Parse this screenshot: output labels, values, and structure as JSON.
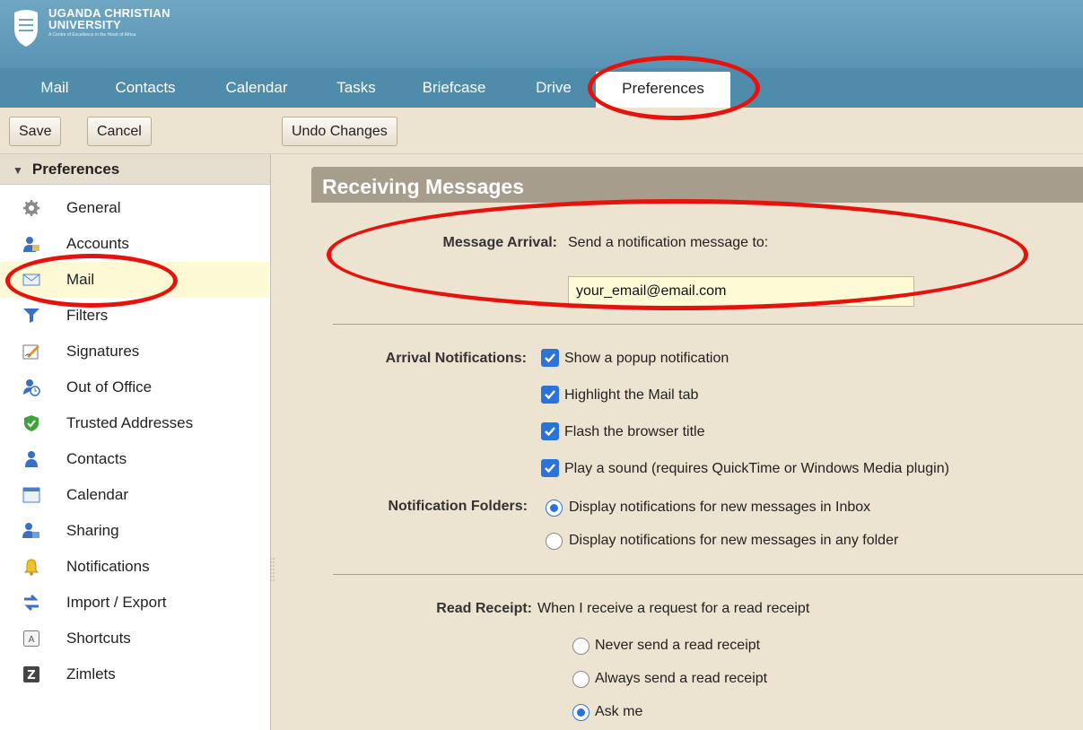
{
  "brand": {
    "line1": "UGANDA CHRISTIAN",
    "line2": "UNIVERSITY",
    "tagline": "A Centre of Excellence in the Heart of Africa"
  },
  "tabs": [
    {
      "label": "Mail"
    },
    {
      "label": "Contacts"
    },
    {
      "label": "Calendar"
    },
    {
      "label": "Tasks"
    },
    {
      "label": "Briefcase"
    },
    {
      "label": "Drive"
    },
    {
      "label": "Preferences"
    }
  ],
  "toolbar": {
    "save_label": "Save",
    "cancel_label": "Cancel",
    "undo_label": "Undo Changes"
  },
  "sidebar": {
    "header": "Preferences",
    "items": [
      {
        "label": "General",
        "icon": "gear-icon"
      },
      {
        "label": "Accounts",
        "icon": "accounts-icon"
      },
      {
        "label": "Mail",
        "icon": "envelope-icon"
      },
      {
        "label": "Filters",
        "icon": "filter-icon"
      },
      {
        "label": "Signatures",
        "icon": "signature-icon"
      },
      {
        "label": "Out of Office",
        "icon": "out-of-office-icon"
      },
      {
        "label": "Trusted Addresses",
        "icon": "shield-icon"
      },
      {
        "label": "Contacts",
        "icon": "person-icon"
      },
      {
        "label": "Calendar",
        "icon": "calendar-icon"
      },
      {
        "label": "Sharing",
        "icon": "sharing-icon"
      },
      {
        "label": "Notifications",
        "icon": "bell-icon"
      },
      {
        "label": "Import / Export",
        "icon": "import-export-icon"
      },
      {
        "label": "Shortcuts",
        "icon": "keyboard-icon"
      },
      {
        "label": "Zimlets",
        "icon": "zimlet-icon"
      }
    ]
  },
  "main": {
    "section_title": "Receiving Messages",
    "message_arrival": {
      "label": "Message Arrival:",
      "text": "Send a notification message to:",
      "email_value": "your_email@email.com"
    },
    "arrival_notifications": {
      "label": "Arrival Notifications:",
      "options": [
        {
          "text": "Show a popup notification",
          "checked": true
        },
        {
          "text": "Highlight the Mail tab",
          "checked": true
        },
        {
          "text": "Flash the browser title",
          "checked": true
        },
        {
          "text": "Play a sound (requires QuickTime or Windows Media plugin)",
          "checked": true
        }
      ]
    },
    "notification_folders": {
      "label": "Notification Folders:",
      "options": [
        {
          "text": "Display notifications for new messages in Inbox",
          "selected": true
        },
        {
          "text": "Display notifications for new messages in any folder",
          "selected": false
        }
      ]
    },
    "read_receipt": {
      "label": "Read Receipt:",
      "text": "When I receive a request for a read receipt",
      "options": [
        {
          "text": "Never send a read receipt",
          "selected": false
        },
        {
          "text": "Always send a read receipt",
          "selected": false
        },
        {
          "text": "Ask me",
          "selected": true
        }
      ]
    }
  },
  "colors": {
    "header": "#5a94b4",
    "tabbar": "#4f8cab",
    "panel": "#ece4d0",
    "section_title_bg": "#a69d8d",
    "accent": "#2b73d9",
    "annotation": "#e8120d"
  }
}
